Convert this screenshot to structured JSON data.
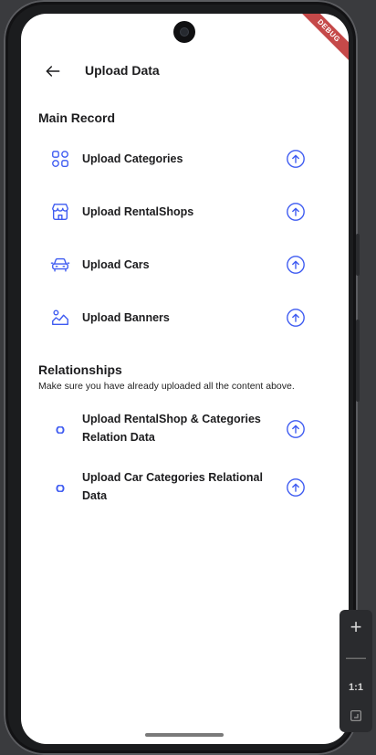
{
  "app_bar": {
    "title": "Upload Data",
    "back_icon": "arrow-left-icon"
  },
  "debug_banner": "DEBUG",
  "main_record": {
    "title": "Main Record",
    "items": [
      {
        "label": "Upload Categories",
        "icon": "categories-icon",
        "action_icon": "upload-circle-icon"
      },
      {
        "label": "Upload RentalShops",
        "icon": "shop-icon",
        "action_icon": "upload-circle-icon"
      },
      {
        "label": "Upload Cars",
        "icon": "car-icon",
        "action_icon": "upload-circle-icon"
      },
      {
        "label": "Upload Banners",
        "icon": "gallery-icon",
        "action_icon": "upload-circle-icon"
      }
    ]
  },
  "relationships": {
    "title": "Relationships",
    "subtitle": "Make sure you have already uploaded all the content above.",
    "items": [
      {
        "label_line1": "Upload RentalShop & Categories",
        "label_line2": "Relation Data",
        "icon": "link-icon",
        "action_icon": "upload-circle-icon"
      },
      {
        "label_line1": "Upload Car Categories Relational",
        "label_line2": "Data",
        "icon": "link-icon",
        "action_icon": "upload-circle-icon"
      }
    ]
  },
  "zoom_controls": {
    "plus": "+",
    "minus": "—",
    "ratio": "1:1"
  },
  "colors": {
    "accent": "#3d5af1",
    "text": "#1c1c1e",
    "background": "#ffffff",
    "debug": "#b71c1c"
  }
}
